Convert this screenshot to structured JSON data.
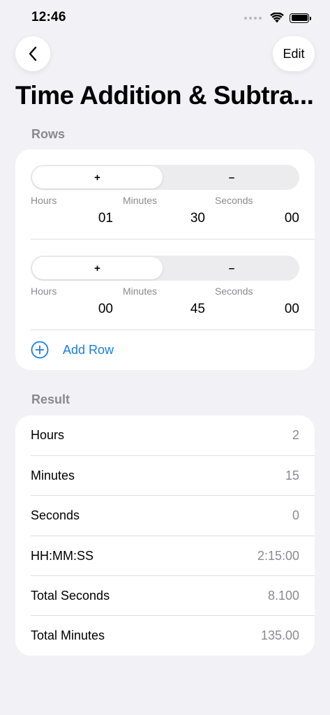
{
  "status": {
    "time": "12:46"
  },
  "nav": {
    "edit_label": "Edit",
    "title": "Time Addition & Subtra..."
  },
  "rows_section": {
    "header": "Rows",
    "rows": [
      {
        "plus": "+",
        "minus": "–",
        "hours_label": "Hours",
        "minutes_label": "Minutes",
        "seconds_label": "Seconds",
        "hours": "01",
        "minutes": "30",
        "seconds": "00"
      },
      {
        "plus": "+",
        "minus": "–",
        "hours_label": "Hours",
        "minutes_label": "Minutes",
        "seconds_label": "Seconds",
        "hours": "00",
        "minutes": "45",
        "seconds": "00"
      }
    ],
    "add_row_label": "Add Row"
  },
  "result_section": {
    "header": "Result",
    "items": [
      {
        "label": "Hours",
        "value": "2"
      },
      {
        "label": "Minutes",
        "value": "15"
      },
      {
        "label": "Seconds",
        "value": "0"
      },
      {
        "label": "HH:MM:SS",
        "value": "2:15:00"
      },
      {
        "label": "Total Seconds",
        "value": "8.100"
      },
      {
        "label": "Total Minutes",
        "value": "135.00"
      }
    ]
  },
  "icons": {
    "back": "chevron-left-icon",
    "add": "plus-circle-icon",
    "wifi": "wifi-icon",
    "battery": "battery-icon"
  },
  "colors": {
    "accent": "#1a7ee0",
    "background": "#f2f1f6",
    "secondary_text": "#8a8a8e"
  }
}
